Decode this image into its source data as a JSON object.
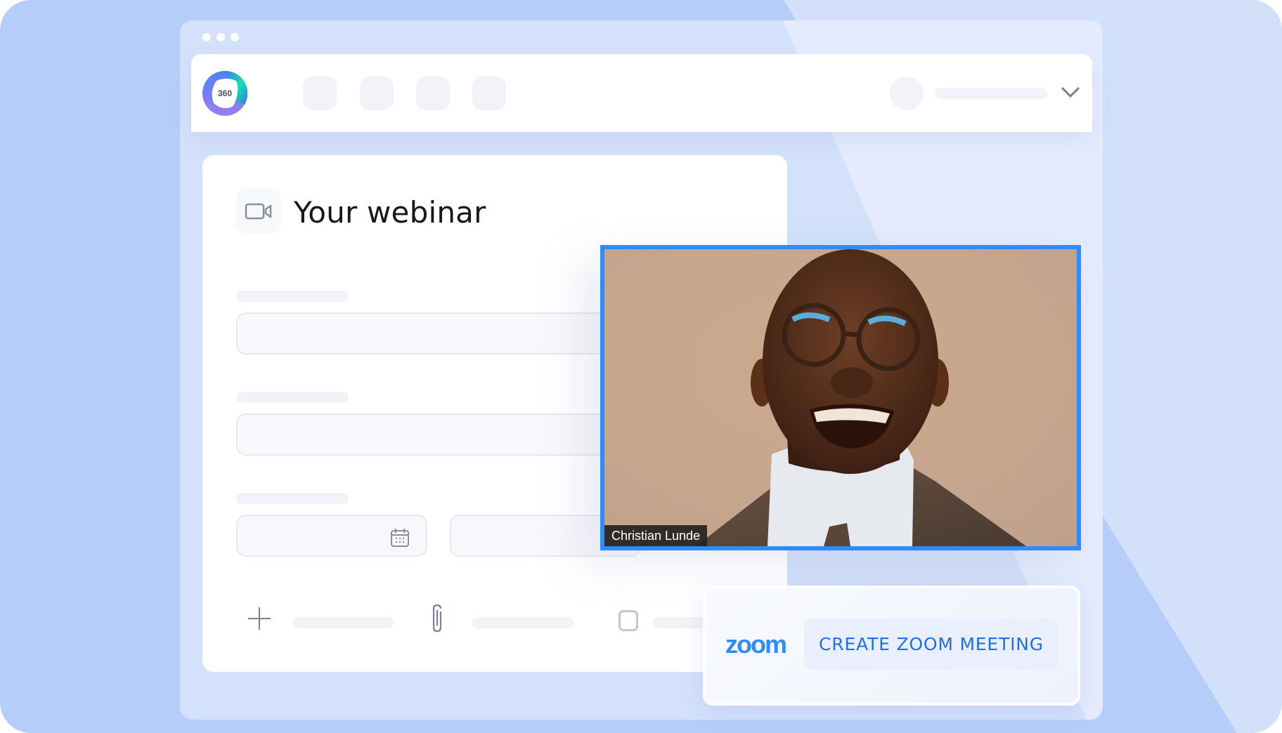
{
  "app": {
    "logo_text": "360",
    "logo_icon": "360-ring-logo",
    "window_controls": [
      "dot",
      "dot",
      "dot"
    ]
  },
  "header": {
    "nav_items": [
      {
        "label": "",
        "icon": "nav-placeholder"
      },
      {
        "label": "",
        "icon": "nav-placeholder"
      },
      {
        "label": "",
        "icon": "nav-placeholder"
      },
      {
        "label": "",
        "icon": "nav-placeholder"
      }
    ],
    "user_menu": {
      "avatar": "avatar-placeholder",
      "name": "",
      "icon": "chevron-down-icon"
    }
  },
  "form": {
    "title": "Your webinar",
    "title_icon": "video-camera-icon",
    "fields": [
      {
        "label": "",
        "value": "",
        "placeholder": ""
      },
      {
        "label": "",
        "value": "",
        "placeholder": ""
      }
    ],
    "date_field": {
      "label": "",
      "value": "",
      "icon": "calendar-icon"
    },
    "time_field": {
      "value": ""
    },
    "footer_actions": [
      {
        "icon": "plus-icon",
        "label": ""
      },
      {
        "icon": "paperclip-icon",
        "label": ""
      },
      {
        "icon": "checkbox-icon",
        "label": ""
      }
    ]
  },
  "video": {
    "participant_name": "Christian Lunde",
    "border_color": "#2D8CFF"
  },
  "zoom_panel": {
    "logo_text": "zoom",
    "button_label": "CREATE ZOOM MEETING",
    "brand_color": "#2D8CFF"
  }
}
